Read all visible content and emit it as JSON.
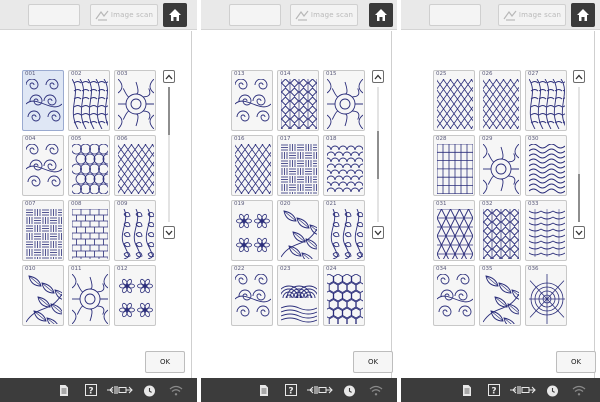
{
  "header": {
    "image_scan_label": "Image scan",
    "scan_icon": "image-scan-icon",
    "home_icon": "home-icon"
  },
  "panels": [
    {
      "id": "page-1",
      "tiles": [
        {
          "number": "001",
          "pattern": "swirl",
          "selected": true
        },
        {
          "number": "002",
          "pattern": "feather",
          "selected": false
        },
        {
          "number": "003",
          "pattern": "ornament",
          "selected": false
        },
        {
          "number": "004",
          "pattern": "swirl",
          "selected": false
        },
        {
          "number": "005",
          "pattern": "circles",
          "selected": false
        },
        {
          "number": "006",
          "pattern": "diamonds",
          "selected": false
        },
        {
          "number": "007",
          "pattern": "basket",
          "selected": false
        },
        {
          "number": "008",
          "pattern": "bricks",
          "selected": false
        },
        {
          "number": "009",
          "pattern": "vines",
          "selected": false
        },
        {
          "number": "010",
          "pattern": "leaves",
          "selected": false
        },
        {
          "number": "011",
          "pattern": "ornament",
          "selected": false
        },
        {
          "number": "012",
          "pattern": "flower",
          "selected": false
        }
      ],
      "scroll_position": 0.0
    },
    {
      "id": "page-2",
      "tiles": [
        {
          "number": "013",
          "pattern": "swirl",
          "selected": false
        },
        {
          "number": "014",
          "pattern": "lattice",
          "selected": false
        },
        {
          "number": "015",
          "pattern": "ornament",
          "selected": false
        },
        {
          "number": "016",
          "pattern": "diamonds",
          "selected": false
        },
        {
          "number": "017",
          "pattern": "basket",
          "selected": false
        },
        {
          "number": "018",
          "pattern": "scales",
          "selected": false
        },
        {
          "number": "019",
          "pattern": "flower",
          "selected": false
        },
        {
          "number": "020",
          "pattern": "leaves",
          "selected": false
        },
        {
          "number": "021",
          "pattern": "vines",
          "selected": false
        },
        {
          "number": "022",
          "pattern": "swirl",
          "selected": false
        },
        {
          "number": "023",
          "pattern": "shell",
          "selected": false
        },
        {
          "number": "024",
          "pattern": "hexagons",
          "selected": false
        }
      ],
      "scroll_position": 0.5
    },
    {
      "id": "page-3",
      "tiles": [
        {
          "number": "025",
          "pattern": "diamonds",
          "selected": false
        },
        {
          "number": "026",
          "pattern": "diamonds",
          "selected": false
        },
        {
          "number": "027",
          "pattern": "feather",
          "selected": false
        },
        {
          "number": "028",
          "pattern": "grid",
          "selected": false
        },
        {
          "number": "029",
          "pattern": "ornament",
          "selected": false
        },
        {
          "number": "030",
          "pattern": "waves",
          "selected": false
        },
        {
          "number": "031",
          "pattern": "triangles",
          "selected": false
        },
        {
          "number": "032",
          "pattern": "lattice",
          "selected": false
        },
        {
          "number": "033",
          "pattern": "chevrons",
          "selected": false
        },
        {
          "number": "034",
          "pattern": "swirl",
          "selected": false
        },
        {
          "number": "035",
          "pattern": "leaves",
          "selected": false
        },
        {
          "number": "036",
          "pattern": "web",
          "selected": false
        }
      ],
      "scroll_position": 1.0
    }
  ],
  "ok_label": "OK",
  "scroll_up_icon": "chevron-up-icon",
  "scroll_down_icon": "chevron-down-icon",
  "statusbar": {
    "icons": [
      "document-icon",
      "help-icon",
      "thread-tension-icon",
      "clock-icon",
      "wifi-icon"
    ],
    "help_glyph": "?"
  },
  "colors": {
    "stitch": "#2a2d7a",
    "selected_tile": "#dfe7f5",
    "statusbar": "#3c3c3c",
    "home_button": "#3a3a3a"
  }
}
